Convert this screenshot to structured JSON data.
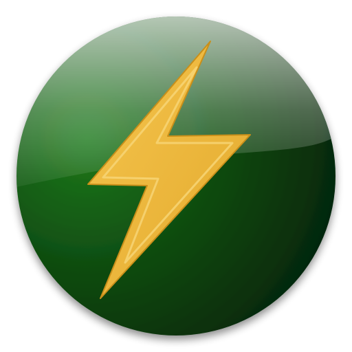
{
  "icon": {
    "name": "lightning-bolt-icon",
    "colors": {
      "disc_light": "#1f7a1c",
      "disc_mid": "#0e4a10",
      "disc_dark": "#021a04",
      "bolt_fill": "#ecb63a",
      "bolt_edge": "#f7d575",
      "gloss": "#ffffff"
    }
  }
}
